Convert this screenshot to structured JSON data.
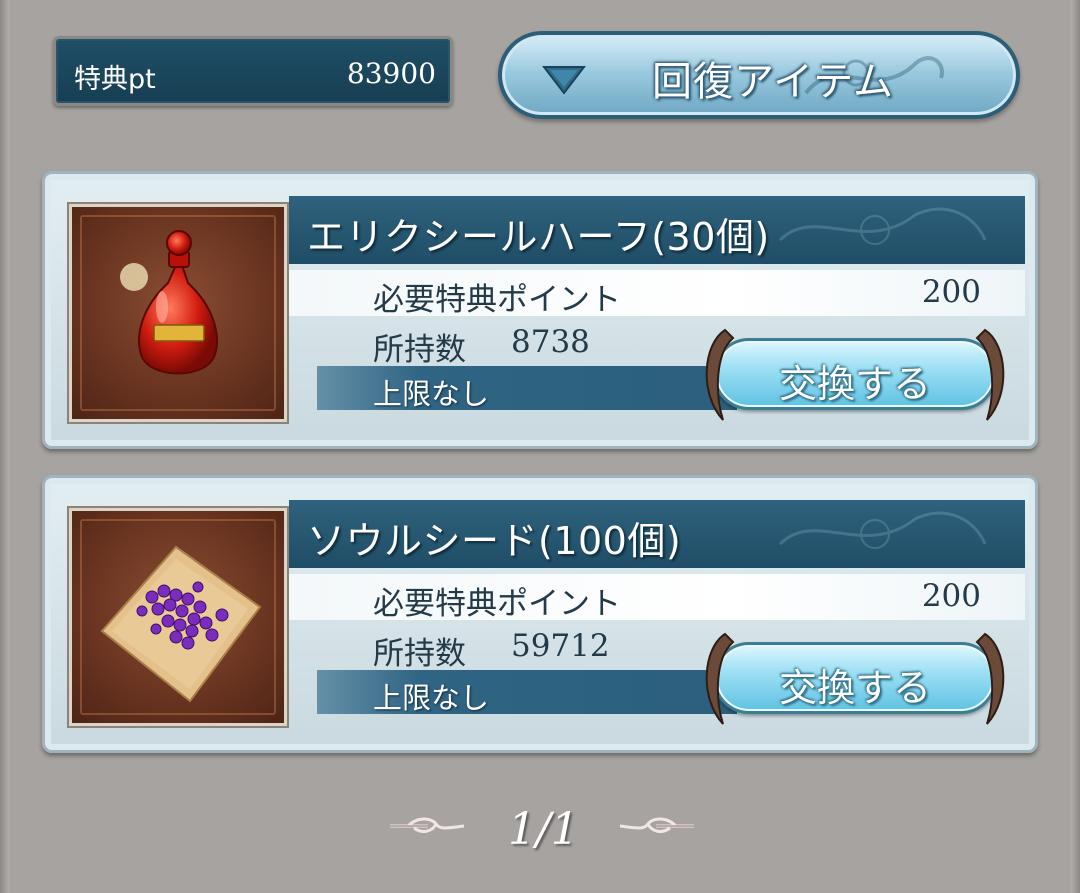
{
  "header": {
    "points_label": "特典pt",
    "points_value": "83900",
    "category_label": "回復アイテム"
  },
  "items": [
    {
      "name": "エリクシールハーフ(30個)",
      "cost_label": "必要特典ポイント",
      "cost_value": "200",
      "owned_label": "所持数",
      "owned_value": "8738",
      "limit_text": "上限なし",
      "button_label": "交換する",
      "icon": "elixir-bottle-icon"
    },
    {
      "name": "ソウルシード(100個)",
      "cost_label": "必要特典ポイント",
      "cost_value": "200",
      "owned_label": "所持数",
      "owned_value": "59712",
      "limit_text": "上限なし",
      "button_label": "交換する",
      "icon": "soul-seeds-icon"
    }
  ],
  "pagination": {
    "indicator": "1/1"
  },
  "colors": {
    "background": "#a7a3a0",
    "title_bar": "#1f4d66",
    "button_light": "#9ee0f4",
    "text_dark": "#233a48"
  }
}
